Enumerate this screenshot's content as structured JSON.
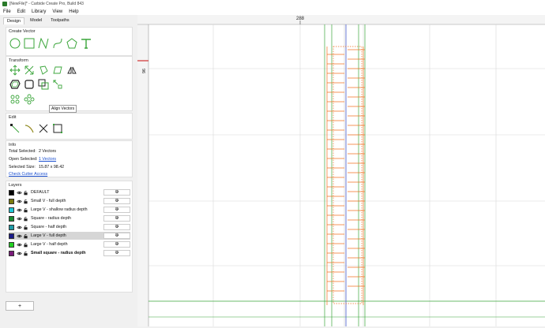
{
  "window": {
    "title": "[NewFile]* - Carbide Create Pro, Build 843"
  },
  "menu": [
    "File",
    "Edit",
    "Library",
    "View",
    "Help"
  ],
  "tabs": [
    "Design",
    "Model",
    "Toolpaths"
  ],
  "sections": {
    "create_vector": "Create Vector",
    "transform": "Transform",
    "edit": "Edit",
    "info": "Info",
    "layers": "Layers"
  },
  "tooltip": "Align Vectors",
  "info": {
    "total_label": "Total Selected:",
    "total_value": "2 Vectors",
    "open_label": "Open Selected:",
    "open_value": "1 Vectors",
    "size_label": "Selected Size:",
    "size_value": "15.87 x 98.42",
    "check_link": "Check Cutter Access"
  },
  "layers": [
    {
      "name": "DEFAULT",
      "color": "#000000",
      "bold": false,
      "selected": false
    },
    {
      "name": "Small V - full depth",
      "color": "#7a7a10",
      "bold": false,
      "selected": false
    },
    {
      "name": "Large V - shallow radius depth",
      "color": "#20c8d8",
      "bold": false,
      "selected": false
    },
    {
      "name": "Square - radius depth",
      "color": "#188a30",
      "bold": false,
      "selected": false
    },
    {
      "name": "Square - half depth",
      "color": "#1e9aa6",
      "bold": false,
      "selected": false
    },
    {
      "name": "Large V - full depth",
      "color": "#1a1a8a",
      "bold": false,
      "selected": true
    },
    {
      "name": "Large V - half depth",
      "color": "#22d022",
      "bold": false,
      "selected": false
    },
    {
      "name": "Small square - radius depth",
      "color": "#7a1a7a",
      "bold": true,
      "selected": false
    }
  ],
  "add_label": "+",
  "ruler": {
    "top": "288",
    "left": "96"
  },
  "colors": {
    "vector_green": "#3aa53a",
    "toolpath_orange": "#f07020",
    "selection_blue": "#5a6ad0",
    "grid": "#d8d8d8"
  }
}
